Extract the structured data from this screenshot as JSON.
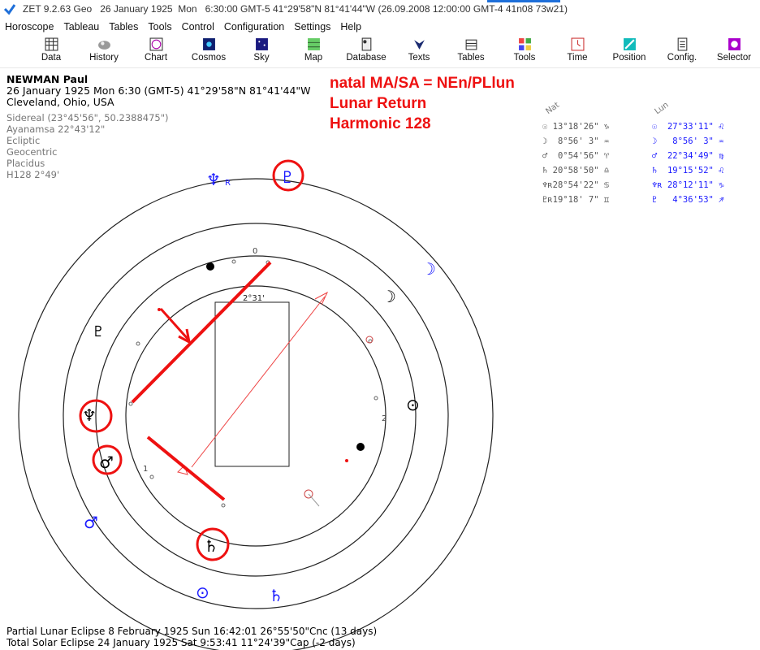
{
  "titlebar": {
    "app": "ZET 9.2.63 Geo",
    "date": "26 January 1925",
    "day": "Mon",
    "details": "6:30:00 GMT-5 41°29'58\"N  81°41'44\"W  (26.09.2008  12:00:00 GMT-4 41n08 73w21)"
  },
  "menu": [
    "Horoscope",
    "Tableau",
    "Tables",
    "Tools",
    "Control",
    "Configuration",
    "Settings",
    "Help"
  ],
  "toolbar": [
    {
      "label": "Data",
      "icon": "data-grid-icon"
    },
    {
      "label": "History",
      "icon": "history-icon"
    },
    {
      "label": "Chart",
      "icon": "chart-wheel-icon"
    },
    {
      "label": "Cosmos",
      "icon": "cosmos-icon"
    },
    {
      "label": "Sky",
      "icon": "sky-icon"
    },
    {
      "label": "Map",
      "icon": "map-icon"
    },
    {
      "label": "Database",
      "icon": "database-icon"
    },
    {
      "label": "Texts",
      "icon": "texts-icon"
    },
    {
      "label": "Tables",
      "icon": "tables-icon"
    },
    {
      "label": "Tools",
      "icon": "tools-icon"
    },
    {
      "label": "Time",
      "icon": "time-icon"
    },
    {
      "label": "Position",
      "icon": "position-icon"
    },
    {
      "label": "Config.",
      "icon": "config-icon"
    },
    {
      "label": "Selector",
      "icon": "selector-icon"
    }
  ],
  "person": {
    "name": "NEWMAN Paul",
    "datetime": "26 January 1925  Mon   6:30 (GMT-5) 41°29'58\"N  81°41'44\"W",
    "place": "Cleveland, Ohio, USA"
  },
  "settings": [
    "Sidereal (23°45'56\", 50.2388475\")",
    "Ayanamsa 22°43'12\"",
    "Ecliptic",
    "Geocentric",
    "Placidus",
    "H128   2°49'"
  ],
  "annotations": {
    "line1": "natal MA/SA = NEn/PLlun",
    "line2": "Lunar Return",
    "line3": "Harmonic 128"
  },
  "columns": {
    "natal": "Nat",
    "lunar": "Lun"
  },
  "natal_positions": [
    {
      "glyph": "☉",
      "text": " 13°18'26\" ♑"
    },
    {
      "glyph": "☽",
      "text": "  8°56' 3\" ♒"
    },
    {
      "glyph": "♂",
      "text": "  0°54'56\" ♈"
    },
    {
      "glyph": "♄",
      "text": " 20°58'50\" ♎"
    },
    {
      "glyph": "♆ʀ",
      "text": "28°54'22\" ♋"
    },
    {
      "glyph": "♇ʀ",
      "text": "19°18' 7\" ♊"
    }
  ],
  "lunar_positions": [
    {
      "glyph": "☉",
      "text": "  27°33'11\" ♌"
    },
    {
      "glyph": "☽",
      "text": "   8°56' 3\" ♒"
    },
    {
      "glyph": "♂",
      "text": "  22°34'49\" ♍"
    },
    {
      "glyph": "♄",
      "text": "  19°15'52\" ♌"
    },
    {
      "glyph": "♆ʀ",
      "text": " 28°12'11\" ♑"
    },
    {
      "glyph": "♇",
      "text": "   4°36'53\" ♐"
    }
  ],
  "wheel": {
    "degree_label": "2°31'",
    "tick_0": "0",
    "tick_1": "1",
    "tick_2": "2"
  },
  "eclipses": [
    "Partial Lunar Eclipse 8 February 1925 Sun 16:42:01 26°55'50\"Cnc (13 days)",
    "Total Solar Eclipse 24 January 1925 Sat  9:53:41 11°24'39\"Cap (-2 days)"
  ],
  "colors": {
    "annotation": "#ee1111",
    "lunar": "#1a1aff",
    "natal": "#000000",
    "window_accent": "#1e6fd9"
  }
}
